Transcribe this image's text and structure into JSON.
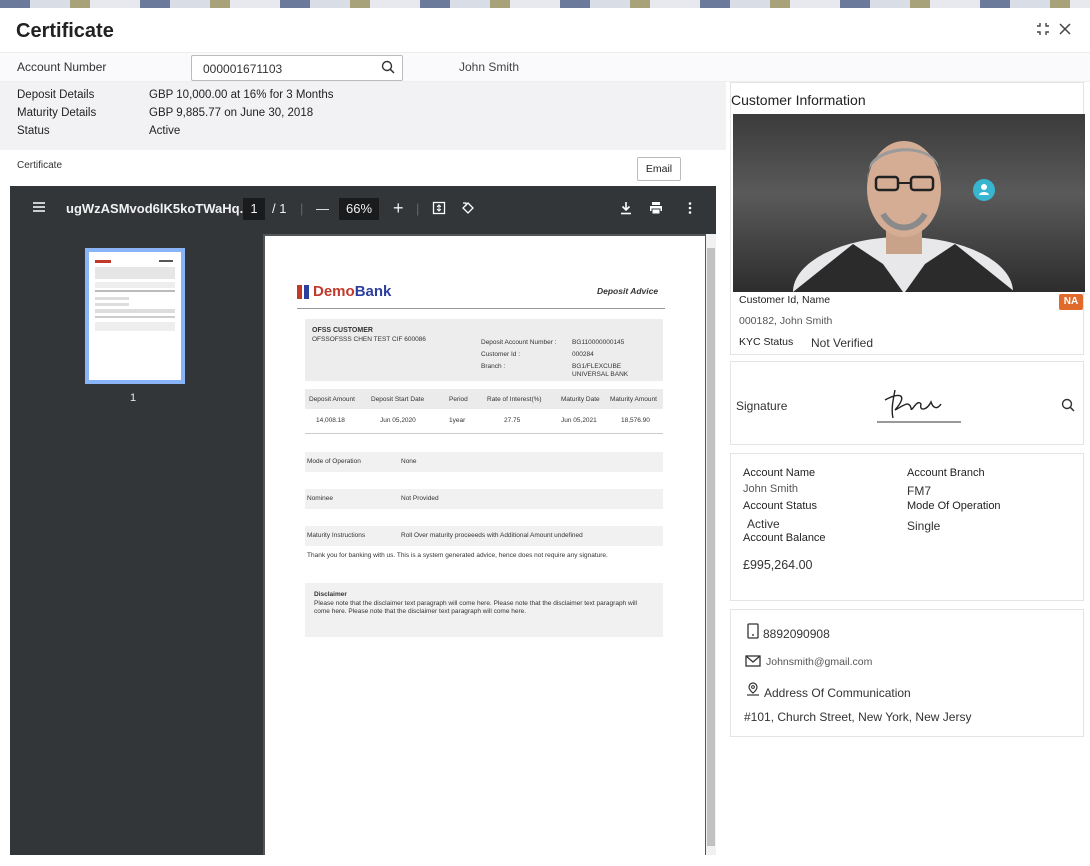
{
  "header": {
    "title": "Certificate",
    "collapse_icon": "compress-icon",
    "close_icon": "close-icon"
  },
  "account": {
    "label": "Account Number",
    "value": "000001671103",
    "search_icon": "search-icon",
    "name": "John Smith"
  },
  "details": [
    {
      "label": "Deposit Details",
      "value": "GBP 10,000.00 at 16% for 3 Months"
    },
    {
      "label": "Maturity Details",
      "value": "GBP 9,885.77 on June 30, 2018"
    },
    {
      "label": "Status",
      "value": "Active"
    }
  ],
  "certificate": {
    "label": "Certificate",
    "email_button": "Email"
  },
  "pdf": {
    "menu_icon": "menu-icon",
    "filename": "ugWzASMvod6lK5koTWaHq...",
    "page_current": "1",
    "page_total": "/ 1",
    "zoom_out": "—",
    "zoom": "66%",
    "zoom_in": "+",
    "fit_icon": "fit-page-icon",
    "rotate_icon": "rotate-icon",
    "download_icon": "download-icon",
    "print_icon": "print-icon",
    "more_icon": "more-vert-icon",
    "thumb_label": "1"
  },
  "doc": {
    "logo": "DemoBank",
    "logo_demo": "Demo",
    "logo_bank": "Bank",
    "heading": "Deposit Advice",
    "customer_title": "OFSS CUSTOMER",
    "customer_line": "OFSSOFSSS CHEN TEST CIF 600086",
    "acc_no_label": "Deposit Account Number :",
    "acc_no": "BG110000000145",
    "cust_id_label": "Customer Id :",
    "cust_id": "000284",
    "branch_label": "Branch :",
    "branch_l1": "BG1/FLEXCUBE",
    "branch_l2": "UNIVERSAL BANK",
    "table_headers": [
      "Deposit Amount",
      "Deposit Start Date",
      "Period",
      "Rate of Interest(%)",
      "Maturity Date",
      "Maturity Amount"
    ],
    "table_values": [
      "14,008.18",
      "Jun 05,2020",
      "1year",
      "27.75",
      "Jun 05,2021",
      "18,576.90"
    ],
    "mode_label": "Mode of Operation",
    "mode_value": "None",
    "nominee_label": "Nominee",
    "nominee_value": "Not Provided",
    "instr_label": "Maturity Instructions",
    "instr_value": "Roll Over maturity proceeeds with Additional Amount undefined",
    "thanks": "Thank you for banking with us. This is a system generated advice, hence does not require any signature.",
    "disclaimer_title": "Disclaimer",
    "disclaimer_l1": "Please note that the disclaimer text paragraph will come here. Please note that the disclaimer text paragraph will",
    "disclaimer_l2": "come here. Please note that the disclaimer text paragraph will come here."
  },
  "customer": {
    "title": "Customer Information",
    "id_name_label": "Customer Id, Name",
    "id_name": "000182, John Smith",
    "badge": "NA",
    "kyc_label": "KYC Status",
    "kyc_value": "Not Verified",
    "photo_icon": "person-badge-icon"
  },
  "signature": {
    "label": "Signature",
    "search_icon": "search-icon"
  },
  "account_info": {
    "name_label": "Account Name",
    "name": "John Smith",
    "branch_label": "Account Branch",
    "branch": "FM7",
    "status_label": "Account Status",
    "status": "Active",
    "mode_label": "Mode Of Operation",
    "mode": "Single",
    "balance_label": "Account Balance",
    "balance": "£995,264.00"
  },
  "contact": {
    "phone_icon": "phone-icon",
    "phone": "8892090908",
    "email_icon": "mail-icon",
    "email": "Johnsmith@gmail.com",
    "address_icon": "location-pin-icon",
    "address_label": "Address Of Communication",
    "address": "#101, Church Street, New York, New Jersy"
  }
}
